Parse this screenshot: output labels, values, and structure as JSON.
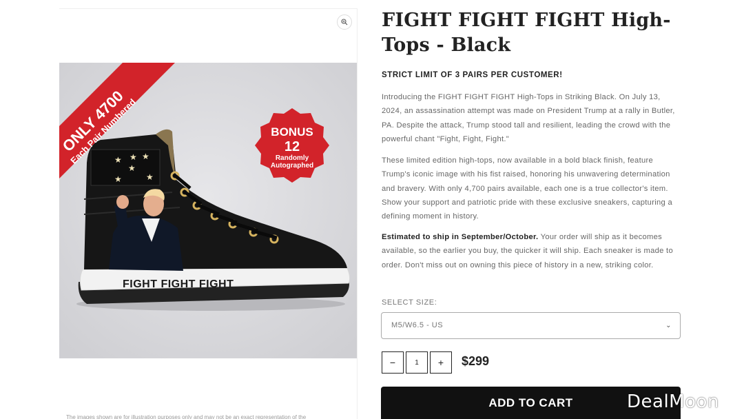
{
  "product": {
    "title": "FIGHT FIGHT FIGHT High-Tops - Black",
    "limit_notice": "STRICT LIMIT OF 3 PAIRS PER CUSTOMER!",
    "description_1": "Introducing the FIGHT FIGHT FIGHT High-Tops in Striking Black. On July 13, 2024, an assassination attempt was made on President Trump at a rally in Butler, PA. Despite the attack, Trump stood tall and resilient, leading the crowd with the powerful chant \"Fight, Fight, Fight.\"",
    "description_2": "These limited edition high-tops, now available in a bold black finish, feature Trump's iconic image with his fist raised, honoring his unwavering determination and bravery. With only 4,700 pairs available, each one is a true collector's item. Show your support and patriotic pride with these exclusive sneakers, capturing a defining moment in history.",
    "ship_bold": "Estimated to ship in September/October.",
    "ship_text": " Your order will ship as it becomes available, so the earlier you buy, the quicker it will ship. Each sneaker is made to order. Don't miss out on owning this piece of history in a new, striking color.",
    "size_label": "SELECT SIZE:",
    "size_value": "M5/W6.5 - US",
    "quantity": "1",
    "qty_minus": "−",
    "qty_plus": "+",
    "price": "$299",
    "add_to_cart": "ADD TO CART"
  },
  "image": {
    "banner_line1": "ONLY 4700",
    "banner_line2": "Each Pair Numbered",
    "bonus_line1": "BONUS",
    "bonus_line2": "12",
    "bonus_line3": "Randomly",
    "bonus_line4": "Autographed",
    "shoe_text": "FIGHT FIGHT FIGHT",
    "caption": "The images shown are for illustration purposes only and may not be an exact representation of the"
  },
  "watermark": "DealMoon",
  "icons": {
    "zoom": "zoom-icon",
    "chevron": "chevron-down-icon"
  },
  "colors": {
    "banner": "#d2232a",
    "button": "#111111",
    "accent_gold": "#c9a85a"
  }
}
